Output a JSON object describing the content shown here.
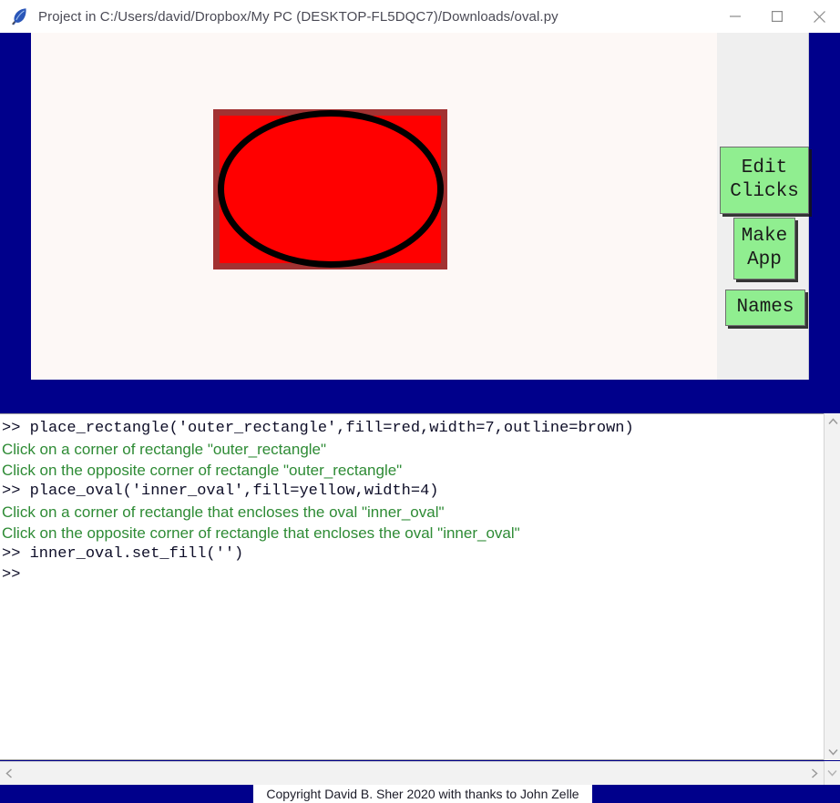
{
  "window": {
    "title": "Project in C:/Users/david/Dropbox/My PC (DESKTOP-FL5DQC7)/Downloads/oval.py",
    "icon": "feather-quill-icon",
    "controls": {
      "minimize_label": "—",
      "maximize_label": "□",
      "close_label": "✕"
    },
    "colors": {
      "frame": "#00008b",
      "canvas": "#fdf8f6",
      "side_panel": "#efefef",
      "button_green": "#90ee90",
      "console_prompt": "#0e0e28",
      "console_message": "#2e8b35"
    }
  },
  "canvas": {
    "shapes": [
      {
        "name": "outer_rectangle",
        "type": "rectangle",
        "fill": "red",
        "outline": "brown",
        "width": 7
      },
      {
        "name": "inner_oval",
        "type": "oval",
        "fill": "",
        "outline": "black",
        "width": 4
      }
    ]
  },
  "sidebar": {
    "buttons": [
      {
        "id": "edit-clicks",
        "label": "Edit\nClicks"
      },
      {
        "id": "make-app",
        "label": "Make\nApp"
      },
      {
        "id": "names",
        "label": "Names"
      }
    ]
  },
  "console": {
    "lines": [
      {
        "kind": "code",
        "text": ">> place_rectangle('outer_rectangle',fill=red,width=7,outline=brown)"
      },
      {
        "kind": "msg",
        "text": "Click on a corner of rectangle \"outer_rectangle\""
      },
      {
        "kind": "msg",
        "text": "Click on the opposite corner of rectangle \"outer_rectangle\""
      },
      {
        "kind": "code",
        "text": ">> place_oval('inner_oval',fill=yellow,width=4)"
      },
      {
        "kind": "msg",
        "text": "Click on a corner of rectangle that encloses the oval \"inner_oval\""
      },
      {
        "kind": "msg",
        "text": "Click on the opposite corner of rectangle that encloses the oval \"inner_oval\""
      },
      {
        "kind": "code",
        "text": ">> inner_oval.set_fill('')"
      },
      {
        "kind": "code",
        "text": ">>"
      }
    ]
  },
  "scrollbars": {
    "vertical_up": "ⱏ",
    "vertical_down": "ⱞ",
    "horizontal_left": "‹",
    "horizontal_right": "›",
    "corner": "ⱞ"
  },
  "status": {
    "copyright": "Copyright David B. Sher 2020 with thanks to John Zelle"
  }
}
